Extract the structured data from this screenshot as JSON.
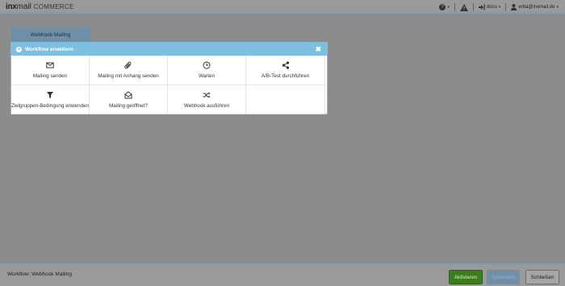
{
  "app": {
    "logo_brand": "inx",
    "logo_mail": "mail",
    "logo_suffix": "COMMERCE"
  },
  "topbar": {
    "help_icon": "question-circle-icon",
    "warning_icon": "warning-triangle-icon",
    "logout_icon": "sign-in-icon",
    "account_label": "docu",
    "user_icon": "user-icon",
    "user_email": "erba@inxmail.de"
  },
  "tab": {
    "label": "Webhook Mailing"
  },
  "modal": {
    "title": "Workflow erweitern",
    "close_icon": "close-icon",
    "items": [
      {
        "label": "Mailing senden",
        "icon": "envelope-icon"
      },
      {
        "label": "Mailing mit Anhang senden",
        "icon": "paperclip-icon"
      },
      {
        "label": "Warten",
        "icon": "clock-icon"
      },
      {
        "label": "A/B-Test durchführen",
        "icon": "share-icon"
      },
      {
        "label": "Zielgruppen-Bedingung anwenden",
        "icon": "filter-icon"
      },
      {
        "label": "Mailing geöffnet?",
        "icon": "envelope-open-icon"
      },
      {
        "label": "Webhook ausführen",
        "icon": "random-icon"
      }
    ]
  },
  "footer": {
    "title": "Workflow: Webhook Mailing",
    "activate_label": "Aktivieren",
    "save_label": "Speichern",
    "close_label": "Schließen"
  },
  "colors": {
    "accent": "#7ebfe0",
    "activate": "#3e7d1e",
    "tab": "#6f8ea8"
  }
}
